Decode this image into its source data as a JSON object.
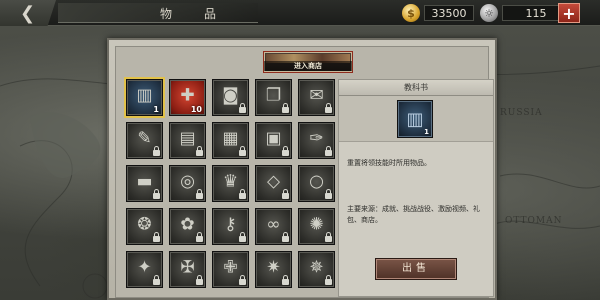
{
  "header": {
    "back_icon": "back-arrow-icon",
    "title": "物　品",
    "gold_amount": "33500",
    "silver_amount": "115",
    "gold_icon": "gold-coin-icon",
    "silver_icon": "silver-coin-icon",
    "add_icon": "plus-icon",
    "add_label": "+"
  },
  "map": {
    "labels": [
      "RUSSIA",
      "OTTOMAN"
    ]
  },
  "panel": {
    "shop_label": "进入商店"
  },
  "items": [
    {
      "icon": "book-icon",
      "glyph": "▥",
      "count": "1",
      "style": "blue",
      "selected": true,
      "locked": false
    },
    {
      "icon": "medal-badge-icon",
      "glyph": "✚",
      "count": "10",
      "style": "red",
      "selected": false,
      "locked": false
    },
    {
      "icon": "barrel-icon",
      "glyph": "◙",
      "count": "",
      "style": "dark",
      "selected": false,
      "locked": true
    },
    {
      "icon": "document-stack-icon",
      "glyph": "❐",
      "count": "",
      "style": "dark",
      "selected": false,
      "locked": true
    },
    {
      "icon": "letters-icon",
      "glyph": "✉",
      "count": "",
      "style": "dark",
      "selected": false,
      "locked": true
    },
    {
      "icon": "paper-scroll-icon",
      "glyph": "✎",
      "count": "",
      "style": "dark",
      "selected": false,
      "locked": true
    },
    {
      "icon": "newspaper-icon",
      "glyph": "▤",
      "count": "",
      "style": "dark",
      "selected": false,
      "locked": true
    },
    {
      "icon": "orders-paper-icon",
      "glyph": "▦",
      "count": "",
      "style": "dark",
      "selected": false,
      "locked": true
    },
    {
      "icon": "folder-icon",
      "glyph": "▣",
      "count": "",
      "style": "dark",
      "selected": false,
      "locked": true
    },
    {
      "icon": "scroll-icon",
      "glyph": "✑",
      "count": "",
      "style": "dark",
      "selected": false,
      "locked": true
    },
    {
      "icon": "truck-icon",
      "glyph": "▬",
      "count": "",
      "style": "dark",
      "selected": false,
      "locked": true
    },
    {
      "icon": "ring-icon",
      "glyph": "◎",
      "count": "",
      "style": "dark",
      "selected": false,
      "locked": true
    },
    {
      "icon": "crown-icon",
      "glyph": "♛",
      "count": "",
      "style": "dark",
      "selected": false,
      "locked": true
    },
    {
      "icon": "necklace-icon",
      "glyph": "◇",
      "count": "",
      "style": "dark",
      "selected": false,
      "locked": true
    },
    {
      "icon": "bracelet-icon",
      "glyph": "○",
      "count": "",
      "style": "dark",
      "selected": false,
      "locked": true
    },
    {
      "icon": "brooch-icon",
      "glyph": "❂",
      "count": "",
      "style": "dark",
      "selected": false,
      "locked": true
    },
    {
      "icon": "wreath-icon",
      "glyph": "✿",
      "count": "",
      "style": "dark",
      "selected": false,
      "locked": true
    },
    {
      "icon": "key-icon",
      "glyph": "⚷",
      "count": "",
      "style": "dark",
      "selected": false,
      "locked": true
    },
    {
      "icon": "pearl-chain-icon",
      "glyph": "∞",
      "count": "",
      "style": "dark",
      "selected": false,
      "locked": true
    },
    {
      "icon": "gear-medal-icon",
      "glyph": "✺",
      "count": "",
      "style": "dark",
      "selected": false,
      "locked": true
    },
    {
      "icon": "star-medal-icon",
      "glyph": "✦",
      "count": "",
      "style": "dark",
      "selected": false,
      "locked": true
    },
    {
      "icon": "cross-medal-icon",
      "glyph": "✠",
      "count": "",
      "style": "dark",
      "selected": false,
      "locked": true
    },
    {
      "icon": "iron-cross-icon",
      "glyph": "✙",
      "count": "",
      "style": "dark",
      "selected": false,
      "locked": true
    },
    {
      "icon": "star-order-icon",
      "glyph": "✷",
      "count": "",
      "style": "dark",
      "selected": false,
      "locked": true
    },
    {
      "icon": "eagle-medal-icon",
      "glyph": "✵",
      "count": "",
      "style": "dark",
      "selected": false,
      "locked": true
    }
  ],
  "detail": {
    "title": "教科书",
    "icon": "book-icon",
    "glyph": "▥",
    "count": "1",
    "description": "重置将领技能时所用物品。",
    "source": "主要来源：成就、挑战战役、激励视频、礼包、商店。",
    "sell_label": "出售"
  }
}
